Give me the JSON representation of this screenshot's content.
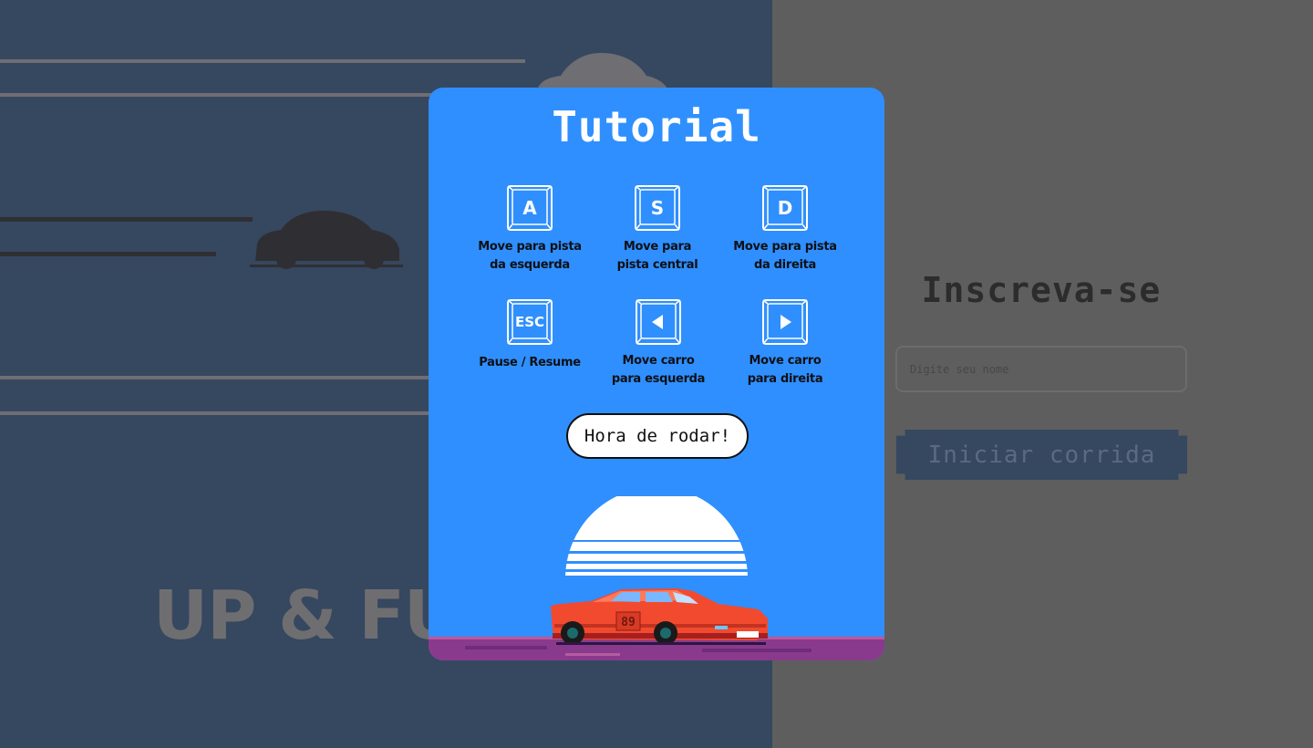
{
  "background": {
    "brand_title": "UP & FUR"
  },
  "signup": {
    "title": "Inscreva-se",
    "name_placeholder": "Digite seu nome",
    "name_value": "",
    "start_button": "Iniciar corrida"
  },
  "tutorial": {
    "title": "Tutorial",
    "controls": [
      {
        "key": "A",
        "icon": "key-a-icon",
        "description_line1": "Move para pista",
        "description_line2": "da esquerda"
      },
      {
        "key": "S",
        "icon": "key-s-icon",
        "description_line1": "Move para",
        "description_line2": "pista central"
      },
      {
        "key": "D",
        "icon": "key-d-icon",
        "description_line1": "Move para pista",
        "description_line2": "da direita"
      },
      {
        "key": "ESC",
        "icon": "key-esc-icon",
        "description_line1": "Pause / Resume",
        "description_line2": ""
      },
      {
        "key": "",
        "icon": "arrow-left-key-icon",
        "description_line1": "Move carro",
        "description_line2": "para esquerda"
      },
      {
        "key": "",
        "icon": "arrow-right-key-icon",
        "description_line1": "Move carro",
        "description_line2": "para direita"
      }
    ],
    "go_button": "Hora de rodar!",
    "car_number": "89"
  },
  "colors": {
    "modal_bg": "#2f8ffe",
    "left_bg": "#364760",
    "right_bg": "#5e5e5e",
    "car_red": "#f24a2e",
    "ground_purple": "#8a3a8c"
  }
}
